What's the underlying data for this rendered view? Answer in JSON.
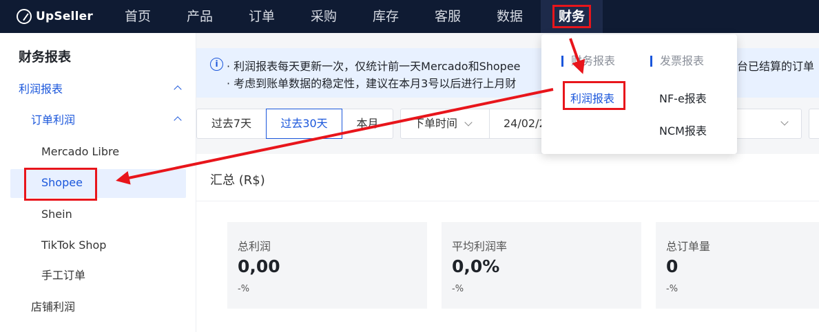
{
  "brand": {
    "name": "UpSeller"
  },
  "nav": {
    "items": [
      "首页",
      "产品",
      "订单",
      "采购",
      "库存",
      "客服",
      "数据",
      "财务"
    ],
    "active_index": 7
  },
  "sidebar": {
    "title": "财务报表",
    "items": [
      {
        "label": "利润报表",
        "expanded": true
      },
      {
        "label": "订单利润",
        "expanded": true
      },
      {
        "label": "Mercado Libre"
      },
      {
        "label": "Shopee",
        "selected": true
      },
      {
        "label": "Shein"
      },
      {
        "label": "TikTok Shop"
      },
      {
        "label": "手工订单"
      },
      {
        "label": "店铺利润"
      }
    ]
  },
  "notice": {
    "line1": "· 利润报表每天更新一次，仅统计前一天Mercado和Shopee",
    "line1_tail": "台已结算的订单",
    "line2": "· 考虑到账单数据的稳定性，建议在本月3号以后进行上月财"
  },
  "filters": {
    "ranges": [
      "过去7天",
      "过去30天",
      "本月"
    ],
    "selected_range": "过去30天",
    "date_type": "下单时间",
    "date_value": "24/02/2"
  },
  "summary": {
    "title": "汇总 (R$)",
    "cards": [
      {
        "label": "总利润",
        "value": "0,00",
        "change": "-%"
      },
      {
        "label": "平均利润率",
        "value": "0,0%",
        "change": "-%"
      },
      {
        "label": "总订单量",
        "value": "0",
        "change": "-%"
      }
    ]
  },
  "dropdown": {
    "col1_header": "财务报表",
    "col1_items": [
      "利润报表"
    ],
    "col2_header": "发票报表",
    "col2_items": [
      "NF-e报表",
      "NCM报表"
    ]
  },
  "colors": {
    "nav_bg": "#0f1b33",
    "accent": "#1a56db",
    "annotation_red": "#e8151b",
    "notice_bg": "#e8f1ff"
  }
}
